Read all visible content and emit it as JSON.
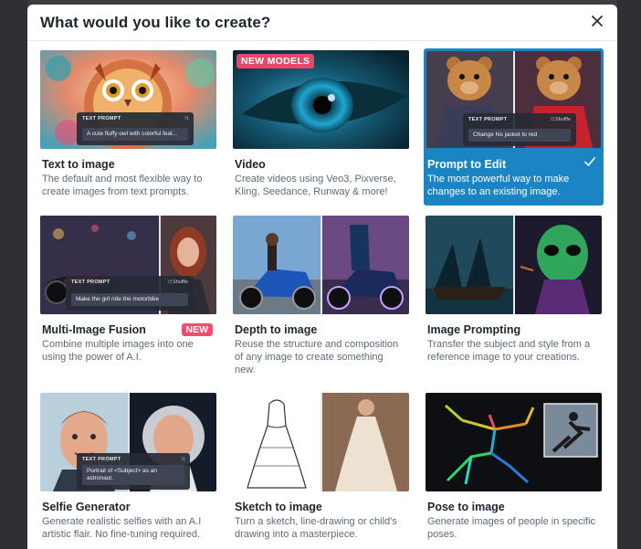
{
  "modal": {
    "title": "What would you like to create?"
  },
  "cards": [
    {
      "title": "Text to image",
      "description": "The default and most flexible way to create images from text prompts.",
      "icon": "owl-image",
      "overlay": {
        "label": "TEXT PROMPT",
        "prompt": "A cute fluffy owl with colorful feat..."
      }
    },
    {
      "title": "Video",
      "description": "Create videos using Veo3, Pixverse, Kling, Seedance, Runway & more!",
      "badge": "NEW MODELS",
      "icon": "eye-image"
    },
    {
      "title": "Prompt to Edit",
      "description": "The most powerful way to make changes to an existing image.",
      "selected": true,
      "icon": "bear-image",
      "overlay": {
        "label": "TEXT PROMPT",
        "shuffle": "Shuffle",
        "prompt": "Change his jacket to red"
      }
    },
    {
      "title": "Multi-Image Fusion",
      "description": "Combine multiple images into one using the power of A.I.",
      "badge": "NEW",
      "icon": "motorbike-girl-image",
      "overlay": {
        "label": "TEXT PROMPT",
        "shuffle": "Shuffle",
        "prompt": "Make the girl ride the motorbike"
      }
    },
    {
      "title": "Depth to image",
      "description": "Reuse the structure and composition of any image to create something new.",
      "icon": "motorbike-image"
    },
    {
      "title": "Image Prompting",
      "description": "Transfer the subject and style from a reference image to your creations.",
      "icon": "alien-image"
    },
    {
      "title": "Selfie Generator",
      "description": "Generate realistic selfies with an A.I artistic flair. No fine-tuning required.",
      "icon": "astronaut-image",
      "overlay": {
        "label": "TEXT PROMPT",
        "prompt": "Portrait of <Subject> as an astronaut."
      }
    },
    {
      "title": "Sketch to image",
      "description": "Turn a sketch, line-drawing or child's drawing into a masterpiece.",
      "icon": "dress-sketch-image"
    },
    {
      "title": "Pose to image",
      "description": "Generate images of people in specific poses.",
      "icon": "pose-skeleton-image"
    }
  ],
  "colors": {
    "selected": "#1b85c4",
    "badge": "#e8476a",
    "title": "#1f2630",
    "description": "#5d6a78"
  }
}
